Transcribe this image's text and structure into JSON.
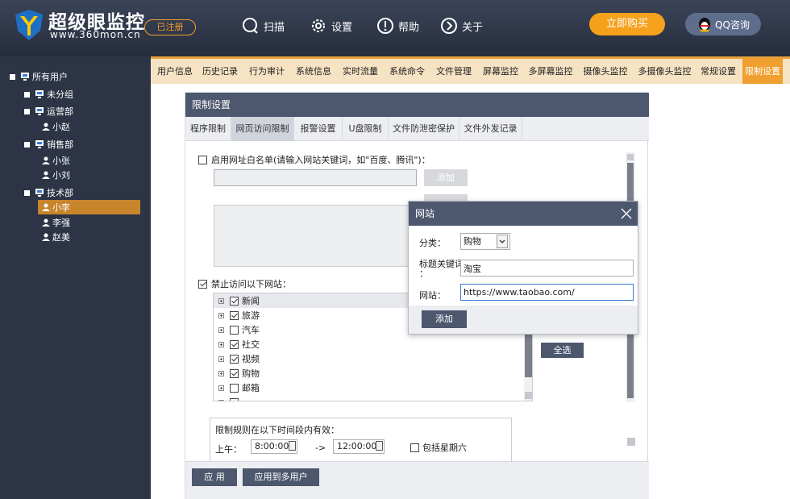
{
  "header": {
    "logo_title": "超级眼监控",
    "logo_url": "www.360mon.cn",
    "registered": "已注册",
    "nav": [
      {
        "label": "扫描",
        "icon": "search-icon"
      },
      {
        "label": "设置",
        "icon": "gear-icon"
      },
      {
        "label": "帮助",
        "icon": "help-icon"
      },
      {
        "label": "关于",
        "icon": "about-icon"
      }
    ],
    "buy": "立即购买",
    "qq": "QQ咨询",
    "colors": {
      "header_bg": "#2b3243",
      "accent": "#f5a11c",
      "qq_bg": "#5f6d8c"
    }
  },
  "sidebar": {
    "root": "所有用户",
    "groups": [
      {
        "name": "未分组",
        "users": []
      },
      {
        "name": "运营部",
        "users": [
          "小赵"
        ]
      },
      {
        "name": "销售部",
        "users": [
          "小张",
          "小刘"
        ]
      },
      {
        "name": "技术部",
        "users": [
          "小李",
          "李强",
          "赵美"
        ]
      }
    ],
    "selected_user": "小李"
  },
  "top_tabs": [
    "用户信息",
    "历史记录",
    "行为审计",
    "系统信息",
    "实时流量",
    "系统命令",
    "文件管理",
    "屏幕监控",
    "多屏幕监控",
    "摄像头监控",
    "多摄像头监控",
    "常规设置",
    "限制设置"
  ],
  "active_top_tab": "限制设置",
  "panel": {
    "title": "限制设置",
    "sub_tabs": [
      "程序限制",
      "网页访问限制",
      "报警设置",
      "U盘限制",
      "文件防泄密保护",
      "文件外发记录"
    ],
    "active_sub_tab": "网页访问限制",
    "whitelist_label": "启用网址白名单(请输入网站关键词，如\"百度、腾讯\")：",
    "whitelist_checked": false,
    "whitelist_input": "",
    "add_label": "添加",
    "block_label": "禁止访问以下网站：",
    "block_checked": true,
    "categories": [
      {
        "name": "新闻",
        "checked": true
      },
      {
        "name": "旅游",
        "checked": true
      },
      {
        "name": "汽车",
        "checked": false
      },
      {
        "name": "社交",
        "checked": true
      },
      {
        "name": "视频",
        "checked": true
      },
      {
        "name": "购物",
        "checked": true
      },
      {
        "name": "邮箱",
        "checked": false
      },
      {
        "name": "",
        "checked": false
      }
    ],
    "select_all": "全选",
    "time_rule_title": "限制规则在以下时间段内有效：",
    "am_label": "上午：",
    "am_start": "8:00:00",
    "am_sep": "->",
    "am_end": "12:00:00",
    "weekend_label": "包括星期六",
    "apply": "应 用",
    "apply_multi": "应用到多用户"
  },
  "dialog": {
    "title": "网站",
    "category_label": "分类：",
    "category_value": "购物",
    "keyword_label_1": "标题关键词",
    "keyword_label_2": "：",
    "keyword_value": "淘宝",
    "site_label": "网站：",
    "site_value": "https://www.taobao.com/",
    "add": "添加"
  }
}
